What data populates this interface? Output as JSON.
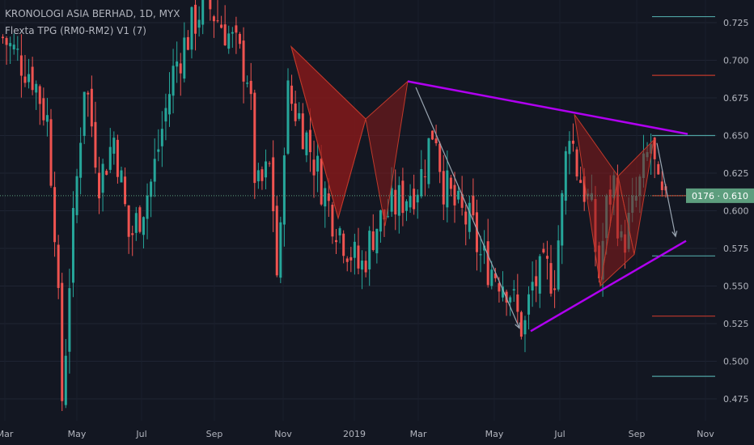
{
  "header": {
    "title": "KRONOLOGI ASIA BERHAD, 1D, MYX",
    "indicator": "Flexta TPG (RM0-RM2) V1 (7)"
  },
  "colors": {
    "background": "#131722",
    "up_candle": "#26a69a",
    "down_candle": "#ef5350",
    "pattern_fill": "#8b1a1a",
    "trendline": "#b000f0",
    "arrow": "#9aa5b1",
    "price_label_bg": "#5d9e7e",
    "level_teal": "#4fa3a3",
    "level_red": "#c0392b"
  },
  "chart_data": {
    "type": "candlestick",
    "title": "KRONOLOGI ASIA BERHAD, 1D, MYX",
    "xlabel": "",
    "ylabel": "",
    "x_ticks": [
      "Mar",
      "May",
      "Jul",
      "Sep",
      "Nov",
      "2019",
      "Mar",
      "May",
      "Jul",
      "Sep",
      "Nov"
    ],
    "y_ticks": [
      "0.725",
      "0.700",
      "0.675",
      "0.650",
      "0.625",
      "0.600",
      "0.575",
      "0.550",
      "0.525",
      "0.500",
      "0.475"
    ],
    "ylim": [
      0.462,
      0.742
    ],
    "grid": true,
    "current_price_label": "0176 · 0.610",
    "current_price": 0.61,
    "price_path": [
      [
        0,
        0.715
      ],
      [
        4,
        0.69
      ],
      [
        6,
        0.66
      ],
      [
        7,
        0.59
      ],
      [
        8,
        0.47
      ],
      [
        9,
        0.56
      ],
      [
        11,
        0.69
      ],
      [
        13,
        0.62
      ],
      [
        15,
        0.65
      ],
      [
        17,
        0.58
      ],
      [
        20,
        0.62
      ],
      [
        23,
        0.695
      ],
      [
        27,
        0.74
      ],
      [
        30,
        0.72
      ],
      [
        33,
        0.69
      ],
      [
        34,
        0.61
      ],
      [
        36,
        0.63
      ],
      [
        37,
        0.54
      ],
      [
        38,
        0.68
      ],
      [
        40,
        0.66
      ],
      [
        42,
        0.63
      ],
      [
        44,
        0.6
      ],
      [
        46,
        0.58
      ],
      [
        48,
        0.56
      ],
      [
        50,
        0.59
      ],
      [
        52,
        0.6
      ],
      [
        54,
        0.61
      ],
      [
        56,
        0.62
      ],
      [
        58,
        0.66
      ],
      [
        59,
        0.62
      ],
      [
        61,
        0.6
      ],
      [
        63,
        0.59
      ],
      [
        64,
        0.57
      ],
      [
        66,
        0.56
      ],
      [
        68,
        0.55
      ],
      [
        69,
        0.53
      ],
      [
        70,
        0.52
      ],
      [
        71,
        0.55
      ],
      [
        73,
        0.56
      ],
      [
        74,
        0.555
      ],
      [
        75,
        0.6
      ],
      [
        76,
        0.66
      ],
      [
        77,
        0.63
      ],
      [
        79,
        0.6
      ],
      [
        80,
        0.555
      ],
      [
        81,
        0.6
      ],
      [
        82,
        0.62
      ],
      [
        83,
        0.575
      ],
      [
        84,
        0.59
      ],
      [
        86,
        0.625
      ],
      [
        87,
        0.645
      ],
      [
        88,
        0.61
      ],
      [
        89,
        0.6
      ]
    ],
    "levels": [
      {
        "value": 0.729,
        "color": "teal"
      },
      {
        "value": 0.69,
        "color": "red"
      },
      {
        "value": 0.65,
        "color": "teal"
      },
      {
        "value": 0.61,
        "color": "red"
      },
      {
        "value": 0.57,
        "color": "teal"
      },
      {
        "value": 0.53,
        "color": "red"
      },
      {
        "value": 0.49,
        "color": "teal"
      }
    ],
    "patterns": [
      {
        "points": [
          [
            0.709,
            0.595
          ],
          [
            0.661,
            0.542
          ],
          [
            0.686,
            0.59
          ]
        ]
      },
      {
        "points": [
          [
            0.664,
            0.623
          ],
          [
            0.623,
            0.55
          ],
          [
            0.623,
            0.571
          ],
          [
            0.647,
            0.55
          ]
        ]
      }
    ],
    "trendlines": [
      {
        "from": [
          0.686,
          0
        ],
        "to": [
          0.651,
          1
        ]
      },
      {
        "from": [
          0.52,
          0
        ],
        "to": [
          0.58,
          1
        ]
      }
    ],
    "arrows": [
      {
        "from": [
          0.682,
          0
        ],
        "to": [
          0.52,
          1
        ]
      },
      {
        "from": [
          0.647,
          0
        ],
        "to": [
          0.58,
          1
        ]
      }
    ]
  }
}
